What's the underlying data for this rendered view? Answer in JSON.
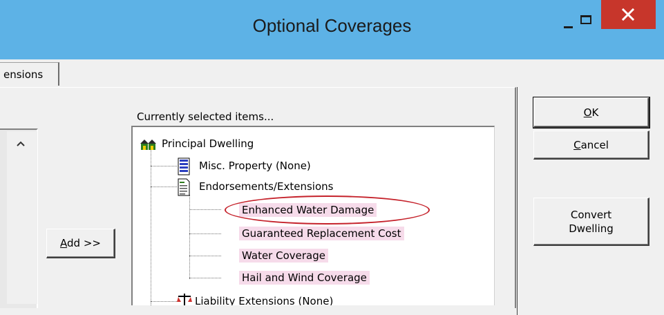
{
  "window": {
    "title": "Optional Coverages",
    "accent_color": "#5db2e6",
    "close_color": "#c7362b"
  },
  "tabs": [
    {
      "label": "ensions"
    }
  ],
  "add_button": {
    "prefix": "A",
    "label": "dd >>"
  },
  "selected": {
    "heading": "Currently selected items...",
    "tree": [
      {
        "label": "Principal Dwelling",
        "icon": "house-icon",
        "level": 0
      },
      {
        "label": "Misc. Property (None)",
        "icon": "stack-icon",
        "level": 1
      },
      {
        "label": "Endorsements/Extensions",
        "icon": "document-icon",
        "level": 1
      },
      {
        "label": "Enhanced Water Damage",
        "level": 2,
        "highlighted": true,
        "circled": true
      },
      {
        "label": "Guaranteed Replacement Cost",
        "level": 2,
        "highlighted": true
      },
      {
        "label": "Water Coverage",
        "level": 2,
        "highlighted": true
      },
      {
        "label": "Hail and Wind Coverage",
        "level": 2,
        "highlighted": true
      },
      {
        "label": "Liability Extensions (None)",
        "icon": "scales-icon",
        "level": 1
      }
    ]
  },
  "buttons": {
    "ok": {
      "accel": "O",
      "rest": "K"
    },
    "cancel": {
      "accel": "C",
      "rest": "ancel"
    },
    "convert": {
      "line1": "Convert",
      "line2": "Dwelling"
    }
  }
}
